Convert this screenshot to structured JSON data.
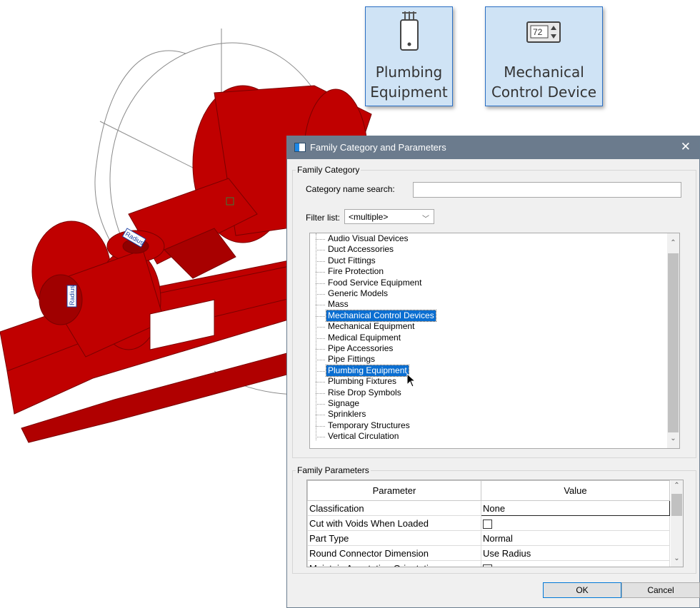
{
  "ribbon": {
    "plumbing_label": "Plumbing\nEquipment",
    "mechanical_label": "Mechanical\nControl Device",
    "thermostat_reading": "72"
  },
  "model": {
    "dimension_label_1": "Radius",
    "dimension_label_2": "Radius",
    "body_color": "#c00000"
  },
  "dialog": {
    "title": "Family Category and Parameters",
    "category_group_label": "Family Category",
    "search_label": "Category name search:",
    "search_value": "",
    "filter_label": "Filter list:",
    "filter_value": "<multiple>",
    "categories": [
      "Audio Visual Devices",
      "Duct Accessories",
      "Duct Fittings",
      "Fire Protection",
      "Food Service Equipment",
      "Generic Models",
      "Mass",
      "Mechanical Control Devices",
      "Mechanical Equipment",
      "Medical Equipment",
      "Pipe Accessories",
      "Pipe Fittings",
      "Plumbing Equipment",
      "Plumbing Fixtures",
      "Rise Drop Symbols",
      "Signage",
      "Sprinklers",
      "Temporary Structures",
      "Vertical Circulation"
    ],
    "selected_categories": [
      "Mechanical Control Devices",
      "Plumbing Equipment"
    ],
    "params_group_label": "Family Parameters",
    "param_columns": [
      "Parameter",
      "Value"
    ],
    "params": [
      {
        "name": "Classification",
        "value": "None"
      },
      {
        "name": "Cut with Voids When Loaded",
        "value": ""
      },
      {
        "name": "Part Type",
        "value": "Normal"
      },
      {
        "name": "Round Connector Dimension",
        "value": "Use Radius"
      },
      {
        "name": "Maintain Annotation Orientation",
        "value": ""
      }
    ],
    "ok_label": "OK",
    "cancel_label": "Cancel",
    "accent": "#0a6ed1"
  }
}
